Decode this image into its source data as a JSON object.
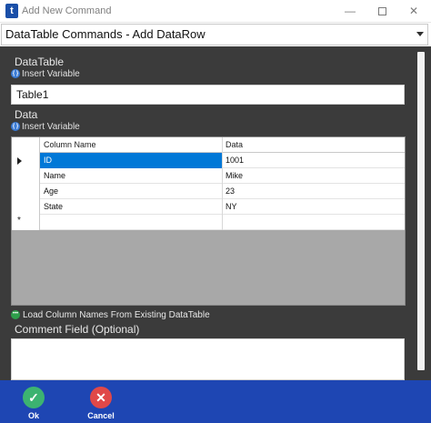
{
  "window": {
    "title": "Add New Command",
    "app_icon_glyph": "t",
    "minimize_glyph": "—",
    "close_glyph": "✕"
  },
  "command_selector": {
    "value": "DataTable Commands - Add DataRow"
  },
  "datatable_section": {
    "label": "DataTable",
    "insert_variable_label": "Insert Variable",
    "value": "Table1"
  },
  "data_section": {
    "label": "Data",
    "insert_variable_label": "Insert Variable",
    "grid": {
      "columns": [
        "Column Name",
        "Data"
      ],
      "rows": [
        {
          "column_name": "ID",
          "data": "1001",
          "selected": true
        },
        {
          "column_name": "Name",
          "data": "Mike"
        },
        {
          "column_name": "Age",
          "data": "23"
        },
        {
          "column_name": "State",
          "data": "NY"
        }
      ],
      "new_row_marker": "*"
    }
  },
  "load_columns_link": "Load Column Names From Existing DataTable",
  "comment_section": {
    "label": "Comment Field (Optional)",
    "value": ""
  },
  "footer": {
    "ok_label": "Ok",
    "cancel_label": "Cancel",
    "ok_glyph": "✓",
    "cancel_glyph": "✕"
  },
  "icons": {
    "app": "app-logo-icon",
    "insert_variable": "variable-braces-icon",
    "load_columns": "load-columns-icon",
    "ok": "checkmark-icon",
    "cancel": "close-icon"
  },
  "colors": {
    "content_background": "#3b3b3b",
    "footer_background": "#1e46b3",
    "selection": "#0078d7",
    "ok": "#3cb371",
    "cancel": "#e04848"
  }
}
